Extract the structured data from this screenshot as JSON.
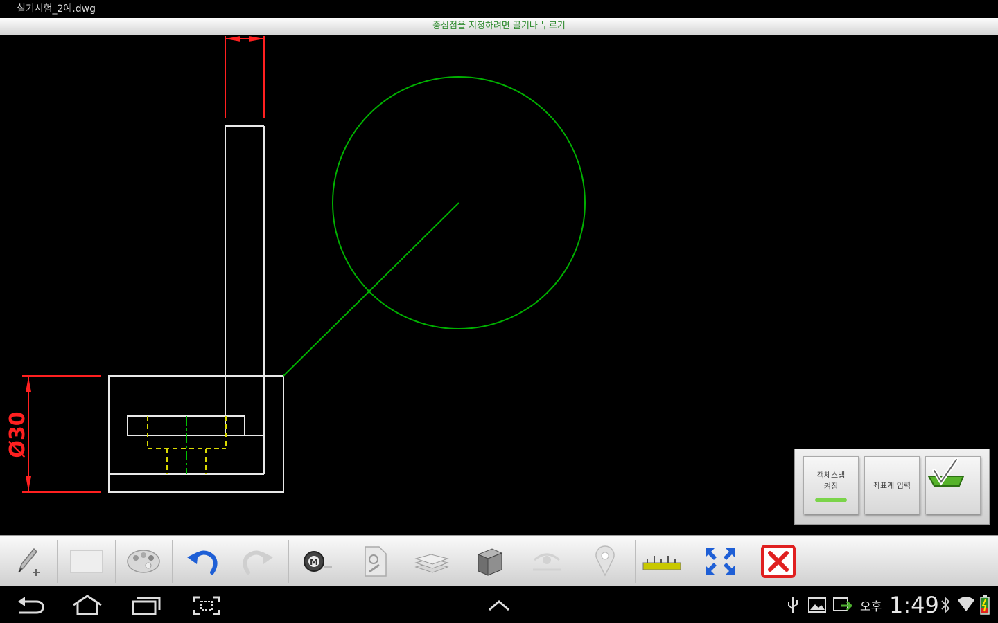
{
  "window": {
    "title": "실기시험_2예.dwg"
  },
  "hint": {
    "text": "중심점을 지정하려면 끌기나 누르기"
  },
  "drawing": {
    "dimension_text": "Ø30",
    "colors": {
      "geometry": "#ffffff",
      "dimension": "#ff0000",
      "circle": "#00c000",
      "hidden": "#d8d800",
      "centerline": "#00c000"
    }
  },
  "snap_panel": {
    "object_snap_label": "객체스냅\n켜짐",
    "coordinate_input_label": "좌표계 입력",
    "confirm_icon": "check-icon"
  },
  "toolbar": {
    "tools": [
      {
        "name": "pencil-add-tool",
        "icon": "pencil-plus-icon"
      },
      {
        "name": "rectangle-tool",
        "icon": "rectangle-icon"
      },
      {
        "name": "palette-tool",
        "icon": "palette-icon"
      },
      {
        "name": "undo-tool",
        "icon": "undo-icon"
      },
      {
        "name": "redo-tool",
        "icon": "redo-icon"
      },
      {
        "name": "measure-tool",
        "icon": "tape-measure-icon"
      },
      {
        "name": "document-tool",
        "icon": "document-gear-icon"
      },
      {
        "name": "layers-tool",
        "icon": "layers-icon"
      },
      {
        "name": "3d-box-tool",
        "icon": "cube-icon"
      },
      {
        "name": "view-tool",
        "icon": "eye-icon"
      },
      {
        "name": "location-tool",
        "icon": "pin-icon"
      },
      {
        "name": "dimension-tool",
        "icon": "ruler-icon"
      },
      {
        "name": "fullscreen-tool",
        "icon": "expand-arrows-icon"
      },
      {
        "name": "close-tool",
        "icon": "close-icon"
      }
    ]
  },
  "statusbar": {
    "ampm": "오후",
    "time": "1:49"
  }
}
